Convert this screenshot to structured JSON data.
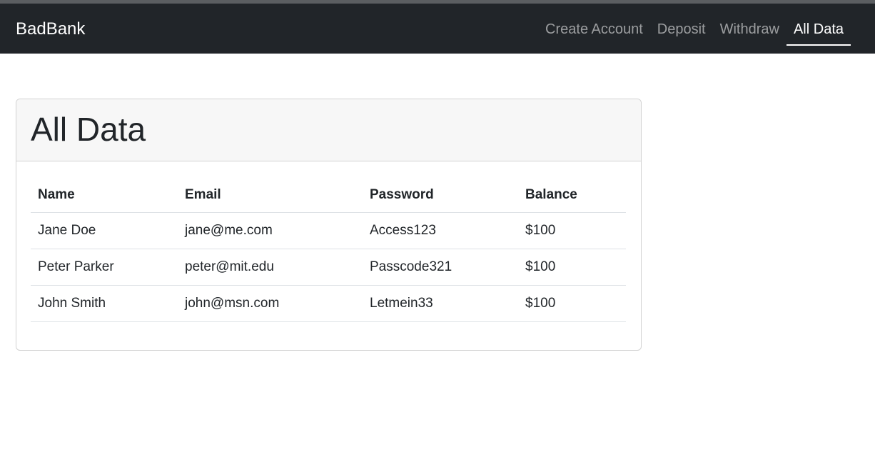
{
  "navbar": {
    "brand": "BadBank",
    "links": [
      {
        "label": "Create Account",
        "active": false
      },
      {
        "label": "Deposit",
        "active": false
      },
      {
        "label": "Withdraw",
        "active": false
      },
      {
        "label": "All Data",
        "active": true
      }
    ]
  },
  "card": {
    "title": "All Data",
    "table": {
      "headers": [
        "Name",
        "Email",
        "Password",
        "Balance"
      ],
      "rows": [
        [
          "Jane Doe",
          "jane@me.com",
          "Access123",
          "$100"
        ],
        [
          "Peter Parker",
          "peter@mit.edu",
          "Passcode321",
          "$100"
        ],
        [
          "John Smith",
          "john@msn.com",
          "Letmein33",
          "$100"
        ]
      ]
    }
  },
  "colors": {
    "navbar_bg": "#212529",
    "card_header_bg": "#f7f7f7",
    "text": "#212529"
  }
}
